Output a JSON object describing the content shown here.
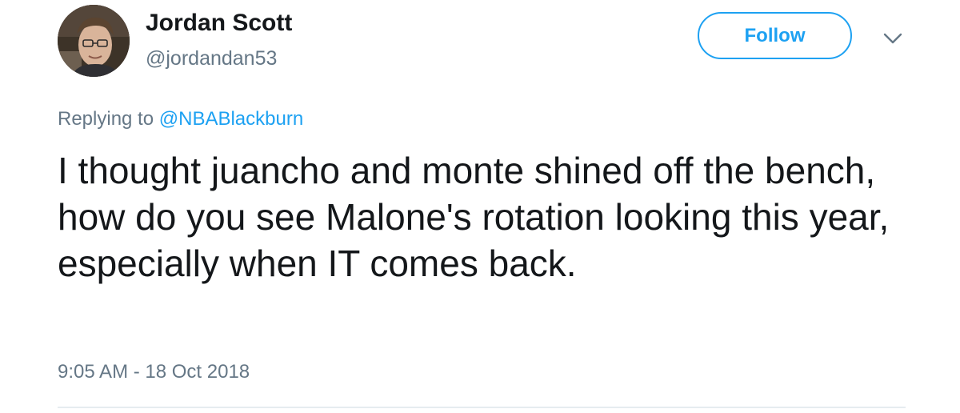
{
  "author": {
    "display_name": "Jordan Scott",
    "handle": "@jordandan53"
  },
  "follow_button": {
    "label": "Follow"
  },
  "menu": {
    "icon": "chevron-down-icon"
  },
  "reply": {
    "prefix": "Replying to ",
    "to_handle": "@NBABlackburn"
  },
  "tweet": {
    "text": "I thought juancho and monte shined off the bench, how do you see Malone's rotation looking this year, especially when IT comes back.",
    "timestamp": "9:05 AM - 18 Oct 2018"
  },
  "colors": {
    "accent": "#1da1f2",
    "text": "#14171a",
    "secondary_text": "#657786",
    "divider": "#e6ecf0"
  }
}
